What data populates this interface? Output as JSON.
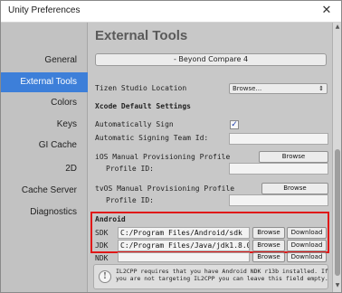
{
  "window": {
    "title": "Unity Preferences",
    "close_glyph": "✕"
  },
  "sidebar": {
    "items": [
      {
        "label": "General",
        "active": false
      },
      {
        "label": "External Tools",
        "active": true
      },
      {
        "label": "Colors",
        "active": false
      },
      {
        "label": "Keys",
        "active": false
      },
      {
        "label": "GI Cache",
        "active": false
      },
      {
        "label": "2D",
        "active": false
      },
      {
        "label": "Cache Server",
        "active": false
      },
      {
        "label": "Diagnostics",
        "active": false
      }
    ],
    "active_color": "#3d7fd9"
  },
  "main": {
    "heading": "External Tools",
    "diff_tool_value": "- Beyond Compare 4",
    "tizen": {
      "label": "Tizen Studio Location",
      "dropdown_value": "Browse...",
      "dropdown_icon": "updown-arrow-icon"
    },
    "xcode": {
      "heading": "Xcode Default Settings",
      "auto_sign_label": "Automatically Sign",
      "auto_sign_checked": "✓",
      "team_id_label": "Automatic Signing Team Id:",
      "team_id_value": "",
      "ios_profile_label": "iOS Manual Provisioning Profile",
      "ios_profile_browse": "Browse",
      "ios_profile_id_label": "Profile ID:",
      "ios_profile_id_value": "",
      "tvos_profile_label": "tvOS Manual Provisioning Profile",
      "tvos_profile_browse": "Browse",
      "tvos_profile_id_label": "Profile ID:",
      "tvos_profile_id_value": ""
    },
    "android": {
      "heading": "Android",
      "sdk_label": "SDK",
      "sdk_value": "C:/Program Files/Android/sdk",
      "sdk_browse": "Browse",
      "sdk_download": "Download",
      "jdk_label": "JDK",
      "jdk_value": "C:/Program Files/Java/jdk1.8.0_1",
      "jdk_browse": "Browse",
      "jdk_download": "Download",
      "ndk_label": "NDK",
      "ndk_value": "",
      "ndk_browse": "Browse",
      "ndk_download": "Download",
      "help_text": "IL2CPP requires that you have Android NDK r13b installed. If you are not targeting IL2CPP you can leave this field empty.",
      "highlight_color": "#e01818"
    }
  }
}
